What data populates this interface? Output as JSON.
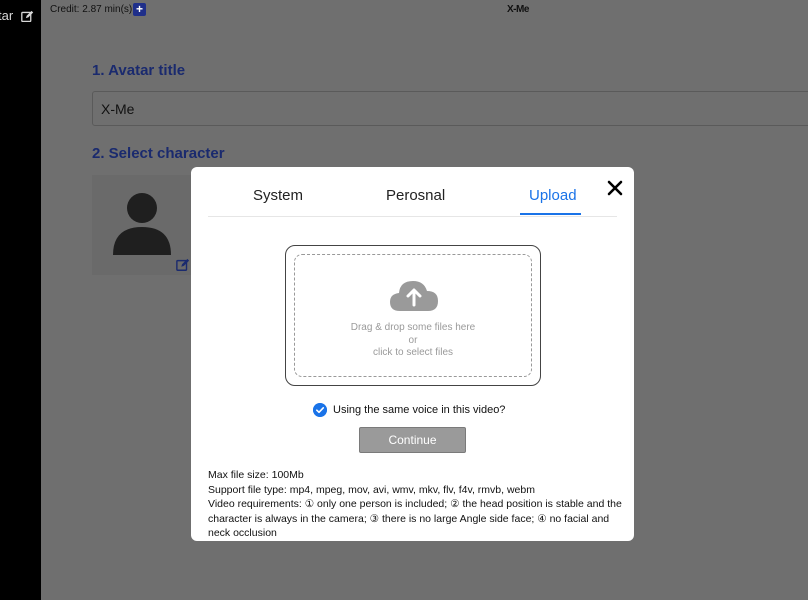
{
  "sidebar": {
    "label": "tar"
  },
  "topbar": {
    "credit": "Credit: 2.87 min(s)",
    "add_label": "+",
    "brand": "X-Me"
  },
  "form": {
    "avatar_title_heading": "1. Avatar title",
    "avatar_title_value": "X-Me",
    "select_character_heading": "2. Select character"
  },
  "modal": {
    "tabs": [
      {
        "label": "System"
      },
      {
        "label": "Perosnal"
      },
      {
        "label": "Upload"
      }
    ],
    "active_tab": "Upload",
    "dropzone": {
      "line1": "Drag & drop some files here",
      "line2": "or",
      "line3": "click to select files"
    },
    "voice_checkbox_label": "Using the same voice in this video?",
    "voice_checked": true,
    "continue_label": "Continue",
    "info": {
      "max_size": "Max file size: 100Mb",
      "file_types": "Support file type: mp4, mpeg, mov, avi, wmv, mkv, flv, f4v, rmvb, webm",
      "requirements": "Video requirements: ① only one person is included; ② the head position is stable and the character is always in the camera; ③ there is no large Angle side face; ④ no facial and neck occlusion"
    }
  },
  "colors": {
    "accent": "#1a73e8",
    "heading": "#1a2a6e",
    "overlay": "#6f6f6f"
  },
  "icons": [
    "edit-icon",
    "plus-icon",
    "person-icon",
    "close-icon",
    "cloud-upload-icon",
    "check-icon"
  ]
}
